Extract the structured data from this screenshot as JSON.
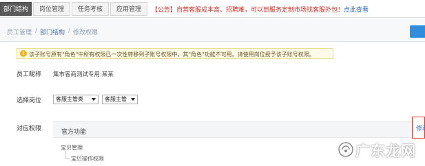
{
  "tabs": [
    {
      "label": "部门结构",
      "active": true
    },
    {
      "label": "岗位管理",
      "active": false
    },
    {
      "label": "任务考核",
      "active": false
    },
    {
      "label": "应用管理",
      "active": false
    }
  ],
  "notice": {
    "text": "【公告】自营客服成本高、招聘难，可以到服务定制市场找客服外包！",
    "link": "点此查看"
  },
  "breadcrumb": {
    "items": [
      "员工管理",
      "部门结构",
      "修改权限"
    ],
    "separator": "/"
  },
  "warning": {
    "icon": "!",
    "text": "该子账号原有\"角色\"中所有权限已一次性转移到子账号权限中，其\"角色\"功能不可用。请使用岗位授予该子账号权限。"
  },
  "form": {
    "nickname_label": "员工昵称",
    "nickname_value": "集市客商测试专用:某某",
    "position_label": "选择岗位",
    "position_select_1": "客服主管类",
    "position_select_2": "客服主管",
    "permission_label": "对应权限"
  },
  "permissions": {
    "header": "官方功能",
    "edit_label": "修改",
    "tree": [
      {
        "label": "宝贝管理",
        "level": 0
      },
      {
        "label": "宝贝操作权限",
        "level": 1
      }
    ]
  },
  "watermark": {
    "text": "广东龙网"
  },
  "colors": {
    "tab_active": "#5a5a5a",
    "notice_red": "#d22b1f",
    "link_blue": "#2a6fc9",
    "warning_bg": "#fffbe8",
    "highlight_red": "#e3372a",
    "button_blue": "#2f8ddc"
  }
}
